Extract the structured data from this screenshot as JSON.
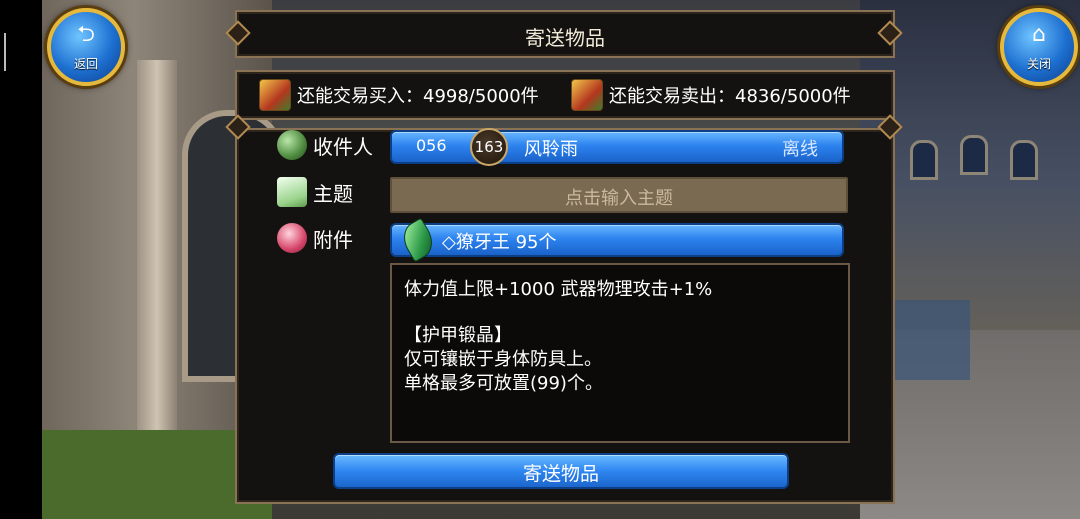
{
  "nav": {
    "back_label": "返回",
    "close_label": "关闭"
  },
  "panel": {
    "title": "寄送物品",
    "trade": {
      "buy_label": "还能交易买入：",
      "buy_value": "4998/5000件",
      "sell_label": "还能交易卖出：",
      "sell_value": "4836/5000件"
    },
    "recipient": {
      "label": "收件人",
      "id": "056",
      "level": "163",
      "name": "风聆雨",
      "status": "离线"
    },
    "subject": {
      "label": "主题",
      "placeholder": "点击输入主题"
    },
    "attachment": {
      "label": "附件",
      "item": "◇獠牙王 95个"
    },
    "description": {
      "line1": "体力值上限+1000 武器物理攻击+1%",
      "line2": "【护甲锻晶】",
      "line3": "仅可镶嵌于身体防具上。",
      "line4": "单格最多可放置(99)个。"
    },
    "send_label": "寄送物品"
  },
  "colors": {
    "accent_blue": "#2d83ef",
    "frame_gold": "#8a7355",
    "panel_bg": "#141210"
  },
  "icons": [
    "back-icon",
    "home-icon",
    "buy-chest-icon",
    "sell-chest-icon",
    "recipient-icon",
    "letter-icon",
    "gift-icon",
    "gem-icon"
  ]
}
